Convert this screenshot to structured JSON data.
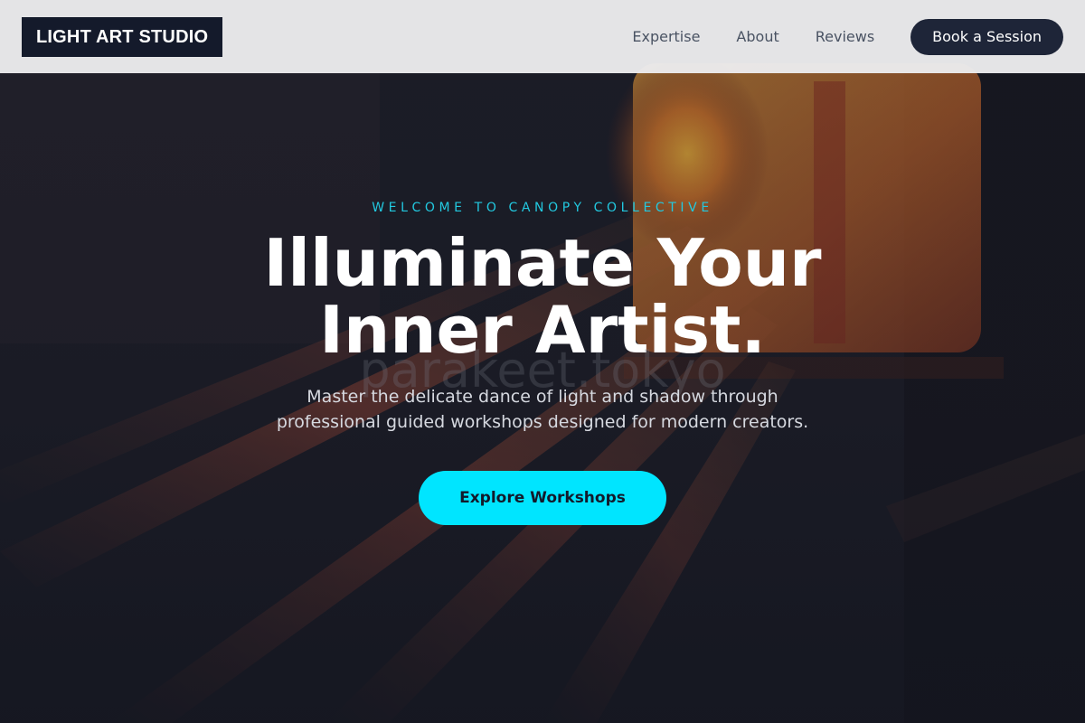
{
  "header": {
    "logo": "LIGHT ART STUDIO",
    "nav": [
      "Expertise",
      "About",
      "Reviews"
    ],
    "cta_label": "Book a Session"
  },
  "hero": {
    "eyebrow": "WELCOME TO CANOPY COLLECTIVE",
    "title_line1": "Illuminate Your",
    "title_line2": "Inner Artist.",
    "watermark": "parakeet.tokyo",
    "subtitle_line1": "Master the delicate dance of light and shadow through",
    "subtitle_line2": "professional guided workshops designed for modern creators.",
    "cta_label": "Explore Workshops"
  },
  "colors": {
    "accent": "#00e5ff",
    "eyebrow": "#22c9e0",
    "header_bg": "#ececee",
    "logo_bg": "#141a2b",
    "header_button_bg": "#1e2538"
  }
}
